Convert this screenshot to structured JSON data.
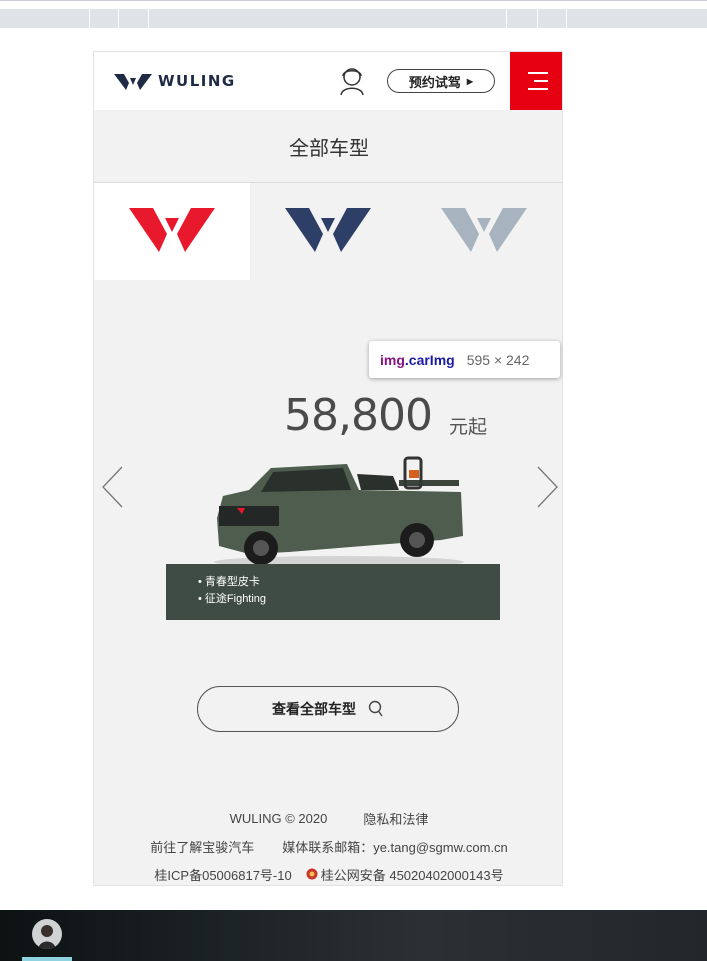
{
  "header": {
    "logo_text": "WULING",
    "test_drive_label": "预约试驾",
    "brand_red": "#e60012"
  },
  "section_title": "全部车型",
  "brand_tabs": [
    {
      "name": "wuling-red",
      "color": "#e8192c",
      "active": true
    },
    {
      "name": "wuling-navy",
      "color": "#2d3f66",
      "active": false
    },
    {
      "name": "wuling-gray",
      "color": "#a7b4c0",
      "active": false
    }
  ],
  "carousel": {
    "price": "58,800",
    "price_unit": "元起",
    "features": [
      "• 青春型皮卡",
      "• 征途Fighting"
    ],
    "prev_icon": "chevron-left-icon",
    "next_icon": "chevron-right-icon"
  },
  "view_all": {
    "label": "查看全部车型"
  },
  "footer": {
    "copyright": "WULING  © 2020",
    "privacy": "隐私和法律",
    "baojun_link": "前往了解宝骏汽车",
    "media_contact": "媒体联系邮箱：ye.tang@sgmw.com.cn",
    "icp": "桂ICP备05006817号-10",
    "police": "桂公网安备 45020402000143号"
  },
  "devtools_tooltip": {
    "selector_tag": "img",
    "selector_class": ".carImg",
    "dimensions": "595 × 242"
  }
}
